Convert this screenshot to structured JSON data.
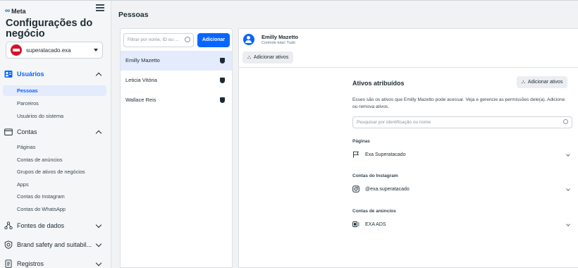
{
  "brand": {
    "logo_text": "Meta"
  },
  "sidebar": {
    "business_title": "Configurações do negócio",
    "account": {
      "name": "superatacado.exa"
    },
    "sections": [
      {
        "label": "Usuários",
        "icon": "users-icon",
        "expanded": true
      },
      {
        "label": "Contas",
        "icon": "accounts-icon",
        "expanded": true
      },
      {
        "label": "Fontes de dados",
        "icon": "data-sources-icon",
        "expanded": false
      },
      {
        "label": "Brand safety and suitabil...",
        "icon": "brand-safety-icon",
        "expanded": false
      },
      {
        "label": "Registros",
        "icon": "registers-icon",
        "expanded": false
      }
    ],
    "users_items": [
      "Pessoas",
      "Parceiros",
      "Usuários do sistema"
    ],
    "accounts_items": [
      "Páginas",
      "Contas de anúncios",
      "Grupos de ativos de negócios",
      "Apps",
      "Contas do Instagram",
      "Contas do WhatsApp"
    ]
  },
  "header": {
    "title": "Pessoas"
  },
  "people_panel": {
    "filter_placeholder": "Filtrar por nome, ID ou ...",
    "add_label": "Adicionar",
    "people": [
      {
        "name": "Emilly Mazetto",
        "selected": true
      },
      {
        "name": "Leticia Vitória",
        "selected": false
      },
      {
        "name": "Wallace Reis",
        "selected": false
      }
    ]
  },
  "detail": {
    "user_name": "Emilly Mazetto",
    "user_sub": "Controle total: Tudo",
    "add_assets_label": "Adicionar ativos",
    "assets_title": "Ativos atribuídos",
    "assets_button_label": "Adicionar ativos",
    "assets_description": "Esses são os ativos que Emilly Mazetto pode acessar. Veja e gerencie as permissões dele(a). Adicione ou remova ativos.",
    "search_placeholder": "Pesquisar por identificação ou nome",
    "categories": [
      {
        "label": "Páginas",
        "asset": "Exa Superatacado",
        "icon": "flag-icon"
      },
      {
        "label": "Contas do Instagram",
        "asset": "@exa.superatacado",
        "icon": "instagram-icon"
      },
      {
        "label": "Contas de anúncios",
        "asset": "EXA ADS",
        "icon": "ad-account-icon"
      }
    ]
  },
  "colors": {
    "accent": "#0866ff",
    "selected_bg": "#e3ebfd"
  }
}
